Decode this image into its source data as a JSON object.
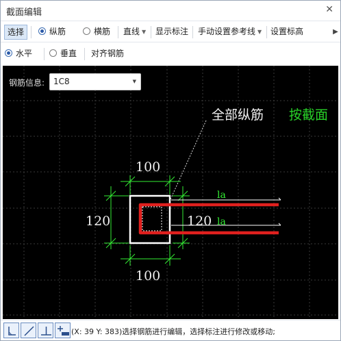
{
  "window": {
    "title": "截面编辑",
    "close_label": "✕"
  },
  "toolbar1": {
    "select": "选择",
    "longitudinal": "纵筋",
    "transverse": "横筋",
    "line": "直线",
    "show_dimensions": "显示标注",
    "manual_reference": "手动设置参考线",
    "set_elevation": "设置标高",
    "more_arrow": "▶"
  },
  "toolbar2": {
    "horizontal": "水平",
    "vertical": "垂直",
    "align_rebar": "对齐钢筋"
  },
  "rebar_info": {
    "label": "钢筋信息:",
    "value": "1C8"
  },
  "drawing": {
    "all_longitudinal": "全部纵筋",
    "by_section": "按截面",
    "dim_top": "100",
    "dim_bottom": "100",
    "dim_left": "120",
    "dim_right": "120",
    "la_top": "la",
    "la_bottom": "la",
    "colors": {
      "background": "#000000",
      "section": "#ffffff",
      "dimension": "#33ee33",
      "rebar": "#e0201e",
      "grid": "#3a3a3a",
      "highlight_text": "#28d228"
    }
  },
  "statusbar": {
    "tools": [
      "corner-tool-icon",
      "diagonal-line-icon",
      "perpendicular-icon",
      "add-rebar-icon"
    ],
    "message": "(X: 39 Y: 383)选择钢筋进行编辑，选择标注进行修改或移动;"
  }
}
